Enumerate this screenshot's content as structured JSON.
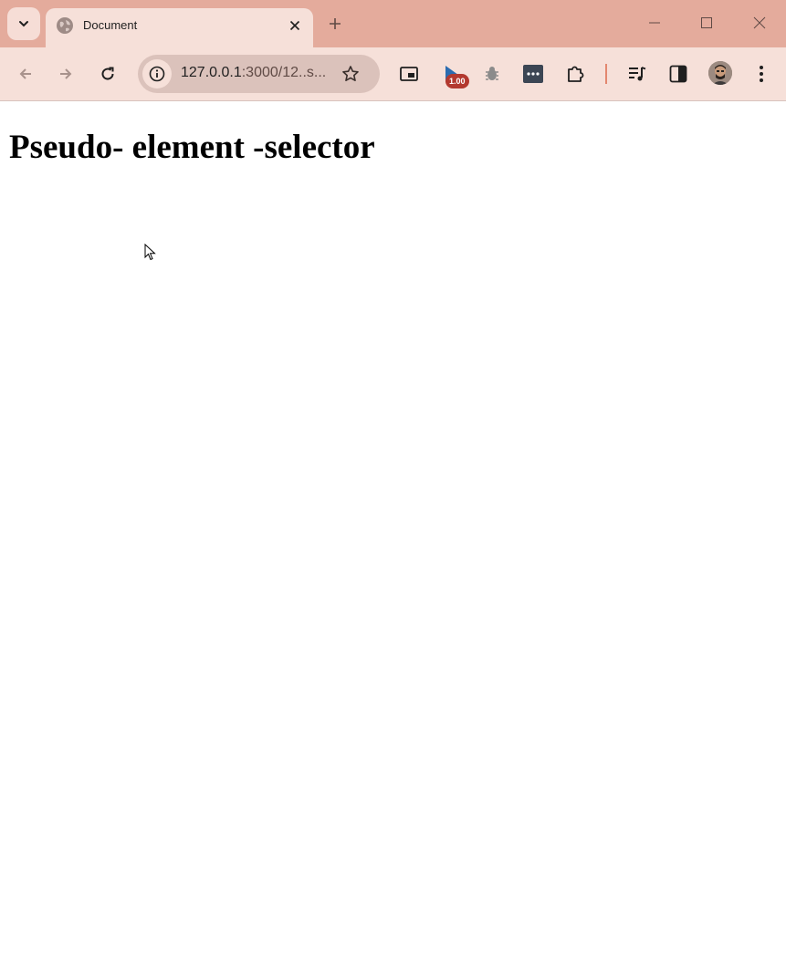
{
  "browser": {
    "tab": {
      "title": "Document"
    },
    "omnibox": {
      "url_host": "127.0.0.1",
      "url_rest": ":3000/12..s..."
    },
    "extensions": {
      "speed_badge": "1.00"
    }
  },
  "page": {
    "heading": "Pseudo- element -selector"
  },
  "colors": {
    "titlebar": "#e4ab9c",
    "toolbar": "#f6e0d9",
    "badge": "#b3392f"
  },
  "icons": {
    "tab_search": "chevron-down-icon",
    "favicon": "globe-icon",
    "tab_close": "close-icon",
    "new_tab": "plus-icon",
    "back": "arrow-left-icon",
    "forward": "arrow-right-icon",
    "reload": "reload-icon",
    "site_info": "info-icon",
    "bookmark": "star-icon",
    "pip": "picture-in-picture-icon",
    "video_speed": "video-speed-icon",
    "bug": "bug-icon",
    "dev_tool": "terminal-icon",
    "extensions": "puzzle-icon",
    "media": "media-queue-icon",
    "side_panel": "side-panel-icon",
    "menu": "kebab-menu-icon"
  }
}
